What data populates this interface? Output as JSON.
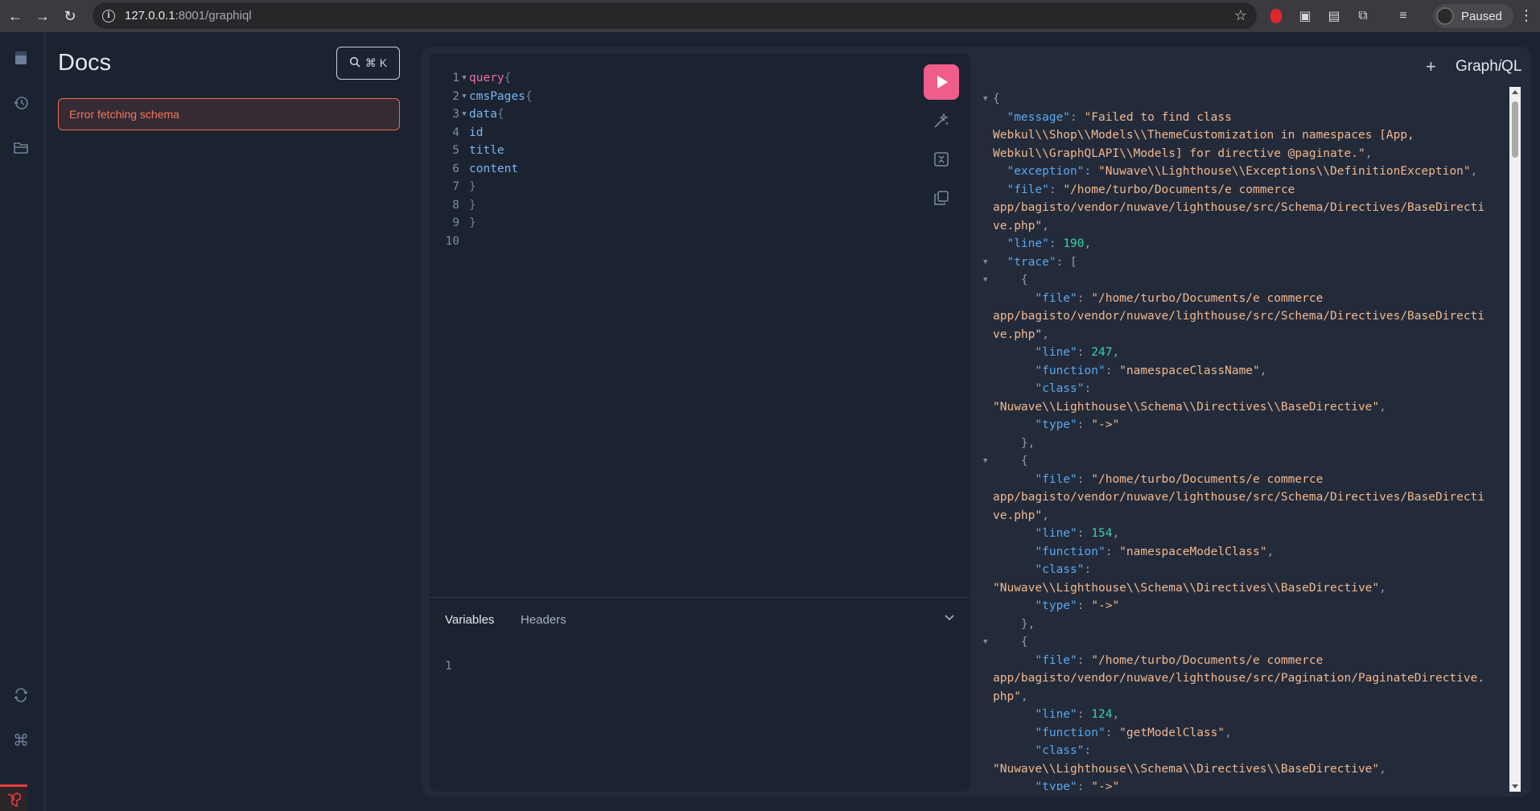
{
  "browser": {
    "url_host": "127.0.0.1",
    "url_rest": ":8001/graphiql",
    "profile_status": "Paused"
  },
  "docs": {
    "title": "Docs",
    "search_shortcut": "⌘ K",
    "error": "Error fetching schema"
  },
  "editor": {
    "lines": [
      {
        "n": "1",
        "fold": true
      },
      {
        "n": "2",
        "fold": true
      },
      {
        "n": "3",
        "fold": true
      },
      {
        "n": "4",
        "fold": false
      },
      {
        "n": "5",
        "fold": false
      },
      {
        "n": "6",
        "fold": false
      },
      {
        "n": "7",
        "fold": false
      },
      {
        "n": "8",
        "fold": false
      },
      {
        "n": "9",
        "fold": false
      },
      {
        "n": "10",
        "fold": false
      }
    ],
    "tokens": {
      "query": "query",
      "cmsPages": "cmsPages",
      "data": "data",
      "id": "id",
      "title": "title",
      "content": "content",
      "open": "{",
      "close": "}"
    }
  },
  "variables": {
    "tab_variables": "Variables",
    "tab_headers": "Headers",
    "line": "1"
  },
  "response": {
    "header_title_a": "Graph",
    "header_title_i": "i",
    "header_title_b": "QL",
    "message_1": "\"Failed to find class",
    "message_2": "Webkul\\\\Shop\\\\Models\\\\ThemeCustomization in namespaces [App,",
    "message_3": "Webkul\\\\GraphQLAPI\\\\Models] for directive @paginate.\"",
    "exception": "\"Nuwave\\\\Lighthouse\\\\Exceptions\\\\DefinitionException\"",
    "file_1": "\"/home/turbo/Documents/e commerce",
    "file_2": "app/bagisto/vendor/nuwave/lighthouse/src/Schema/Directives/BaseDirecti",
    "file_3": "ve.php\"",
    "line": "190",
    "t1_line": "247",
    "t1_function": "\"namespaceClassName\"",
    "t1_class": "\"Nuwave\\\\Lighthouse\\\\Schema\\\\Directives\\\\BaseDirective\"",
    "t_type": "\"->\"",
    "t2_line": "154",
    "t2_function": "\"namespaceModelClass\"",
    "t3_file_2": "app/bagisto/vendor/nuwave/lighthouse/src/Pagination/PaginateDirective.",
    "t3_file_3": "php\"",
    "t3_line": "124",
    "t3_function": "\"getModelClass\""
  }
}
